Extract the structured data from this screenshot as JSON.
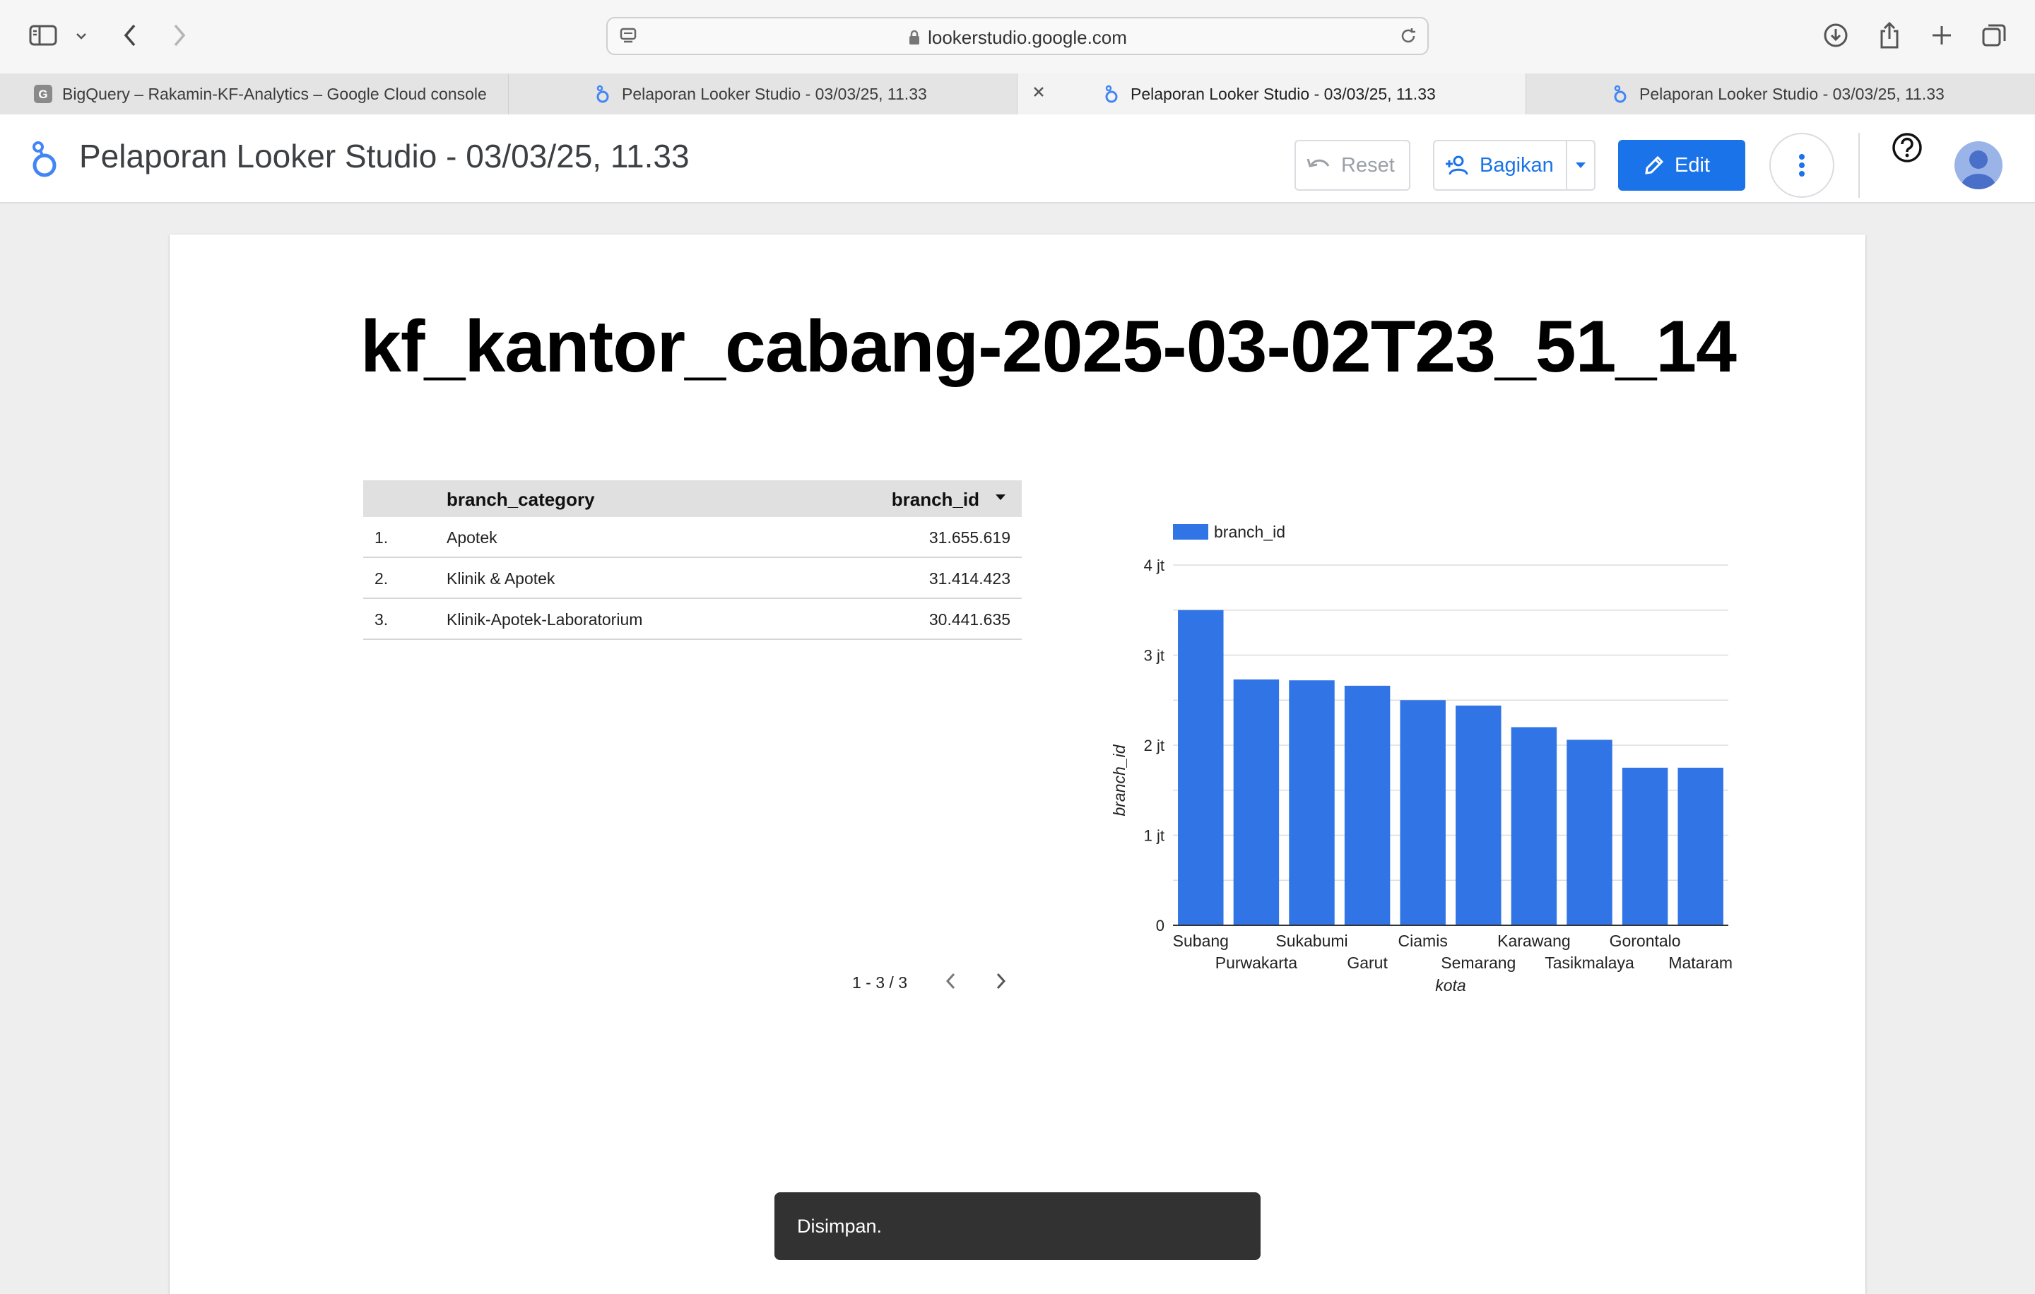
{
  "browser": {
    "url": "lookerstudio.google.com",
    "tabs": [
      {
        "title": "BigQuery – Rakamin-KF-Analytics – Google Cloud console",
        "favicon": "google-cloud-icon",
        "active": false
      },
      {
        "title": "Pelaporan Looker Studio - 03/03/25, 11.33",
        "favicon": "looker-studio-icon",
        "active": false
      },
      {
        "title": "Pelaporan Looker Studio - 03/03/25, 11.33",
        "favicon": "looker-studio-icon",
        "active": true
      },
      {
        "title": "Pelaporan Looker Studio - 03/03/25, 11.33",
        "favicon": "looker-studio-icon",
        "active": false
      }
    ],
    "favicon_letter": "G"
  },
  "header": {
    "report_title": "Pelaporan Looker Studio - 03/03/25, 11.33",
    "reset_label": "Reset",
    "share_label": "Bagikan",
    "edit_label": "Edit"
  },
  "report": {
    "heading": "kf_kantor_cabang-2025-03-02T23_51_14"
  },
  "table": {
    "columns": [
      "branch_category",
      "branch_id"
    ],
    "rows": [
      {
        "index": "1.",
        "category": "Apotek",
        "value": "31.655.619"
      },
      {
        "index": "2.",
        "category": "Klinik & Apotek",
        "value": "31.414.423"
      },
      {
        "index": "3.",
        "category": "Klinik-Apotek-Laboratorium",
        "value": "30.441.635"
      }
    ],
    "pagination": "1 - 3 / 3"
  },
  "chart_data": {
    "type": "bar",
    "categories": [
      "Subang",
      "Purwakarta",
      "Sukabumi",
      "Garut",
      "Ciamis",
      "Semarang",
      "Karawang",
      "Tasikmalaya",
      "Gorontalo",
      "Mataram"
    ],
    "series": [
      {
        "name": "branch_id",
        "values": [
          3500000,
          2730000,
          2720000,
          2660000,
          2500000,
          2440000,
          2200000,
          2060000,
          1750000,
          1750000
        ]
      }
    ],
    "xlabel": "kota",
    "ylabel": "branch_id",
    "ylim": [
      0,
      4000000
    ],
    "yticks": [
      0,
      1000000,
      2000000,
      3000000,
      4000000
    ],
    "ytick_labels": [
      "0",
      "1 jt",
      "2 jt",
      "3 jt",
      "4 jt"
    ],
    "legend_position": "top-left",
    "grid": true,
    "bar_color": "#3074e6"
  },
  "snackbar": {
    "message": "Disimpan."
  },
  "colors": {
    "accent": "#1a73e8",
    "bar": "#3074e6"
  }
}
